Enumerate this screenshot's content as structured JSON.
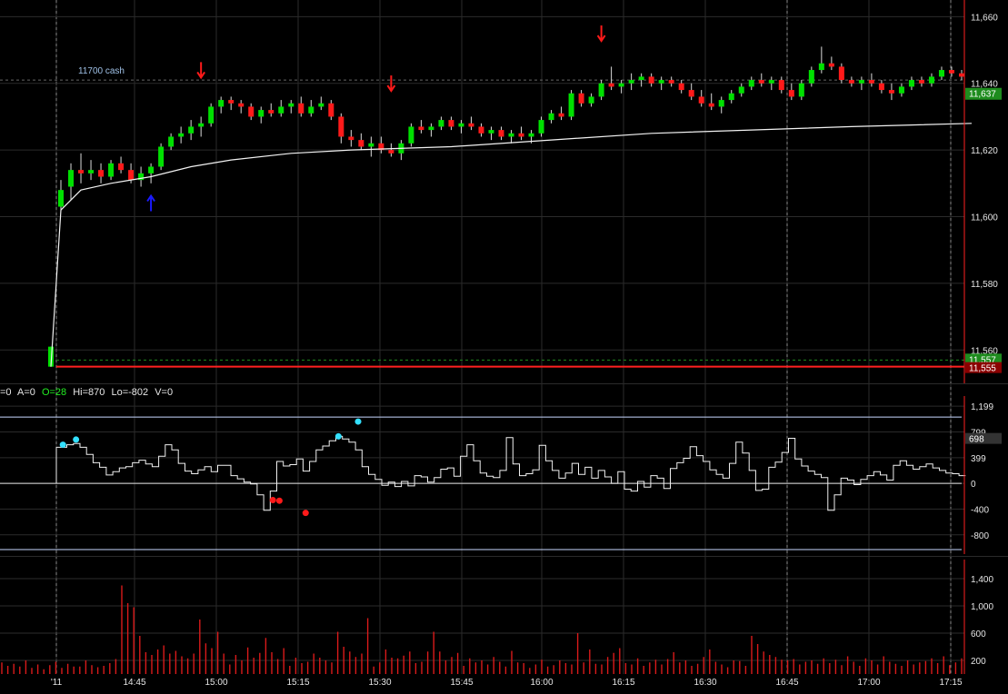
{
  "chart_data": [
    {
      "panel": "price",
      "type": "candlestick",
      "ylim": [
        11550,
        11665
      ],
      "yticks": [
        {
          "value": 11660,
          "label": "11,660"
        },
        {
          "value": 11640,
          "label": "11,640"
        },
        {
          "value": 11620,
          "label": "11,620"
        },
        {
          "value": 11600,
          "label": "11,600"
        },
        {
          "value": 11580,
          "label": "11,580"
        },
        {
          "value": 11560,
          "label": "11,560"
        }
      ],
      "last_price": {
        "value": 11637,
        "label": "11,637",
        "color": "#1e8c1e"
      },
      "level_line": {
        "value": 11555,
        "label": "11,555",
        "color": "#ff2020"
      },
      "level_line2": {
        "value": 11557,
        "label": "11,557",
        "color": "#1e8c1e"
      },
      "annotation": "11700 cash",
      "annotation_value": 11641,
      "up_color": "#00e000",
      "down_color": "#ff1a1a",
      "vwap_color": "#f2f2f2",
      "candles": [
        [
          11555,
          11561,
          11555,
          11561
        ],
        [
          11603,
          11611,
          11602,
          11608
        ],
        [
          11609,
          11616,
          11605,
          11614
        ],
        [
          11614,
          11619,
          11610,
          11613
        ],
        [
          11613,
          11617,
          11611,
          11614
        ],
        [
          11614,
          11616,
          11610,
          11612
        ],
        [
          11612,
          11617,
          11611,
          11616
        ],
        [
          11616,
          11618,
          11613,
          11614
        ],
        [
          11614,
          11616,
          11610,
          11611
        ],
        [
          11611,
          11615,
          11609,
          11613
        ],
        [
          11613,
          11616,
          11610,
          11615
        ],
        [
          11615,
          11622,
          11614,
          11621
        ],
        [
          11621,
          11625,
          11620,
          11624
        ],
        [
          11624,
          11627,
          11622,
          11625
        ],
        [
          11625,
          11629,
          11623,
          11627
        ],
        [
          11627,
          11630,
          11624,
          11628
        ],
        [
          11628,
          11634,
          11627,
          11633
        ],
        [
          11633,
          11636,
          11631,
          11635
        ],
        [
          11635,
          11636,
          11632,
          11634
        ],
        [
          11634,
          11635,
          11631,
          11633
        ],
        [
          11633,
          11634,
          11629,
          11630
        ],
        [
          11630,
          11633,
          11628,
          11632
        ],
        [
          11632,
          11634,
          11630,
          11631
        ],
        [
          11631,
          11635,
          11630,
          11633
        ],
        [
          11633,
          11635,
          11631,
          11634
        ],
        [
          11634,
          11636,
          11630,
          11631
        ],
        [
          11631,
          11635,
          11630,
          11633
        ],
        [
          11633,
          11636,
          11632,
          11634
        ],
        [
          11634,
          11635,
          11629,
          11630
        ],
        [
          11630,
          11631,
          11622,
          11624
        ],
        [
          11624,
          11626,
          11621,
          11623
        ],
        [
          11623,
          11625,
          11620,
          11621
        ],
        [
          11621,
          11624,
          11618,
          11622
        ],
        [
          11622,
          11624,
          11619,
          11620
        ],
        [
          11620,
          11622,
          11618,
          11619
        ],
        [
          11619,
          11623,
          11617,
          11622
        ],
        [
          11622,
          11628,
          11621,
          11627
        ],
        [
          11627,
          11629,
          11625,
          11626
        ],
        [
          11626,
          11628,
          11624,
          11627
        ],
        [
          11627,
          11630,
          11626,
          11629
        ],
        [
          11629,
          11630,
          11626,
          11627
        ],
        [
          11627,
          11629,
          11625,
          11628
        ],
        [
          11628,
          11630,
          11626,
          11627
        ],
        [
          11627,
          11628,
          11624,
          11625
        ],
        [
          11625,
          11627,
          11623,
          11626
        ],
        [
          11626,
          11627,
          11623,
          11624
        ],
        [
          11624,
          11626,
          11622,
          11625
        ],
        [
          11625,
          11627,
          11623,
          11624
        ],
        [
          11624,
          11626,
          11622,
          11625
        ],
        [
          11625,
          11630,
          11624,
          11629
        ],
        [
          11629,
          11632,
          11628,
          11631
        ],
        [
          11631,
          11633,
          11629,
          11630
        ],
        [
          11630,
          11638,
          11629,
          11637
        ],
        [
          11637,
          11638,
          11633,
          11634
        ],
        [
          11634,
          11637,
          11633,
          11636
        ],
        [
          11636,
          11641,
          11635,
          11640
        ],
        [
          11640,
          11645,
          11638,
          11639
        ],
        [
          11639,
          11641,
          11637,
          11640
        ],
        [
          11640,
          11643,
          11638,
          11641
        ],
        [
          11641,
          11643,
          11639,
          11642
        ],
        [
          11642,
          11643,
          11639,
          11640
        ],
        [
          11640,
          11642,
          11638,
          11641
        ],
        [
          11641,
          11642,
          11639,
          11640
        ],
        [
          11640,
          11641,
          11637,
          11638
        ],
        [
          11638,
          11640,
          11635,
          11636
        ],
        [
          11636,
          11638,
          11633,
          11634
        ],
        [
          11634,
          11637,
          11632,
          11633
        ],
        [
          11633,
          11636,
          11631,
          11635
        ],
        [
          11635,
          11638,
          11634,
          11637
        ],
        [
          11637,
          11640,
          11636,
          11639
        ],
        [
          11639,
          11642,
          11638,
          11641
        ],
        [
          11641,
          11643,
          11639,
          11640
        ],
        [
          11640,
          11642,
          11638,
          11641
        ],
        [
          11641,
          11642,
          11637,
          11638
        ],
        [
          11638,
          11640,
          11635,
          11636
        ],
        [
          11636,
          11641,
          11635,
          11640
        ],
        [
          11640,
          11645,
          11639,
          11644
        ],
        [
          11644,
          11651,
          11643,
          11646
        ],
        [
          11646,
          11648,
          11644,
          11645
        ],
        [
          11645,
          11646,
          11640,
          11641
        ],
        [
          11641,
          11642,
          11639,
          11640
        ],
        [
          11640,
          11642,
          11638,
          11641
        ],
        [
          11641,
          11643,
          11639,
          11640
        ],
        [
          11640,
          11641,
          11637,
          11638
        ],
        [
          11638,
          11640,
          11635,
          11637
        ],
        [
          11637,
          11640,
          11636,
          11639
        ],
        [
          11639,
          11642,
          11638,
          11641
        ],
        [
          11641,
          11642,
          11639,
          11640
        ],
        [
          11640,
          11643,
          11639,
          11642
        ],
        [
          11642,
          11645,
          11641,
          11644
        ],
        [
          11644,
          11645,
          11642,
          11643
        ],
        [
          11643,
          11644,
          11641,
          11642
        ]
      ],
      "vwap_points": [
        [
          0,
          11555
        ],
        [
          1,
          11602
        ],
        [
          3,
          11608
        ],
        [
          6,
          11610
        ],
        [
          10,
          11612
        ],
        [
          14,
          11615
        ],
        [
          18,
          11617
        ],
        [
          24,
          11619
        ],
        [
          30,
          11620
        ],
        [
          40,
          11621
        ],
        [
          50,
          11623
        ],
        [
          60,
          11625
        ],
        [
          70,
          11626
        ],
        [
          80,
          11627
        ],
        [
          92,
          11628
        ]
      ],
      "arrows": [
        {
          "index": 10,
          "direction": "up",
          "value": 11606,
          "color": "#1a1aff"
        },
        {
          "index": 15,
          "direction": "down",
          "value": 11642,
          "color": "#ff1a1a"
        },
        {
          "index": 34,
          "direction": "down",
          "value": 11638,
          "color": "#ff1a1a"
        },
        {
          "index": 55,
          "direction": "down",
          "value": 11653,
          "color": "#ff1a1a"
        }
      ]
    },
    {
      "panel": "indicator",
      "type": "step-line",
      "status_text": {
        "prefix": "=0",
        "a": "A=0",
        "o": "O=28",
        "hi": "Hi=870",
        "lo": "Lo=-802",
        "v": "V=0"
      },
      "ylim": [
        -1100,
        1300
      ],
      "yticks": [
        {
          "value": 1199,
          "label": "1,199"
        },
        {
          "value": 799,
          "label": "799"
        },
        {
          "value": 399,
          "label": "399"
        },
        {
          "value": 0,
          "label": "0"
        },
        {
          "value": -400,
          "label": "-400"
        },
        {
          "value": -800,
          "label": "-800"
        }
      ],
      "hlines": [
        1030,
        0,
        -1030
      ],
      "last_value": {
        "value": 698,
        "label": "698"
      },
      "values": [
        0,
        560,
        600,
        620,
        560,
        450,
        320,
        250,
        130,
        180,
        240,
        260,
        320,
        360,
        300,
        260,
        420,
        600,
        520,
        310,
        190,
        150,
        210,
        260,
        180,
        280,
        280,
        120,
        70,
        20,
        -10,
        -180,
        -420,
        -120,
        340,
        270,
        290,
        380,
        190,
        340,
        520,
        580,
        660,
        730,
        690,
        640,
        520,
        260,
        140,
        60,
        -30,
        20,
        -50,
        30,
        -40,
        120,
        100,
        20,
        90,
        220,
        240,
        110,
        420,
        600,
        350,
        160,
        110,
        90,
        200,
        710,
        300,
        120,
        150,
        210,
        590,
        350,
        200,
        80,
        160,
        310,
        140,
        250,
        80,
        200,
        100,
        0,
        180,
        -90,
        -120,
        30,
        -60,
        120,
        80,
        -80,
        230,
        320,
        390,
        570,
        430,
        340,
        210,
        140,
        80,
        310,
        640,
        470,
        200,
        -110,
        -90,
        250,
        330,
        480,
        700,
        380,
        270,
        190,
        140,
        90,
        -420,
        -180,
        80,
        50,
        -20,
        60,
        120,
        180,
        130,
        50,
        280,
        350,
        280,
        220,
        260,
        300,
        240,
        200,
        160,
        150,
        120
      ],
      "markers": [
        {
          "index": 1,
          "value": 600,
          "color": "#33e0ff"
        },
        {
          "index": 3,
          "value": 680,
          "color": "#33e0ff"
        },
        {
          "index": 33,
          "value": -260,
          "color": "#ff1a1a"
        },
        {
          "index": 34,
          "value": -270,
          "color": "#ff1a1a"
        },
        {
          "index": 38,
          "value": -460,
          "color": "#ff1a1a"
        },
        {
          "index": 43,
          "value": 730,
          "color": "#33e0ff"
        },
        {
          "index": 46,
          "value": 960,
          "color": "#33e0ff"
        }
      ]
    },
    {
      "panel": "volume",
      "type": "bar",
      "ylim": [
        0,
        1680
      ],
      "yticks": [
        {
          "value": 1400,
          "label": "1,400"
        },
        {
          "value": 1000,
          "label": "1,000"
        },
        {
          "value": 600,
          "label": "600"
        },
        {
          "value": 200,
          "label": "200"
        }
      ],
      "color": "#d91a1a",
      "values": [
        170,
        120,
        150,
        110,
        200,
        90,
        140,
        70,
        130,
        180,
        90,
        150,
        110,
        110,
        200,
        130,
        100,
        120,
        160,
        220,
        1300,
        1040,
        980,
        560,
        320,
        280,
        360,
        420,
        300,
        340,
        260,
        230,
        300,
        800,
        450,
        380,
        620,
        300,
        140,
        280,
        200,
        390,
        240,
        310,
        530,
        320,
        220,
        380,
        120,
        240,
        160,
        180,
        300,
        240,
        200,
        170,
        620,
        400,
        330,
        250,
        300,
        820,
        110,
        170,
        360,
        240,
        230,
        270,
        330,
        160,
        180,
        330,
        620,
        330,
        200,
        250,
        310,
        120,
        230,
        170,
        200,
        140,
        250,
        180,
        110,
        340,
        170,
        160,
        90,
        140,
        210,
        110,
        130,
        200,
        160,
        140,
        600,
        170,
        360,
        150,
        140,
        250,
        310,
        380,
        160,
        140,
        230,
        120,
        170,
        210,
        140,
        220,
        320,
        170,
        200,
        120,
        150,
        250,
        360,
        180,
        140,
        100,
        200,
        190,
        120,
        560,
        440,
        330,
        280,
        250,
        210,
        200,
        220,
        140,
        180,
        200,
        150,
        230,
        160,
        210,
        130,
        260,
        180,
        120,
        230,
        200,
        140,
        260,
        180,
        150,
        120,
        200,
        140,
        170,
        190,
        230,
        160,
        260,
        130,
        170,
        230
      ]
    },
    {
      "panel": "time-axis",
      "type": "axis",
      "xticks": [
        "'11",
        "14:45",
        "15:00",
        "15:15",
        "15:30",
        "15:45",
        "16:00",
        "16:15",
        "16:30",
        "16:45",
        "17:00",
        "17:15"
      ]
    }
  ]
}
